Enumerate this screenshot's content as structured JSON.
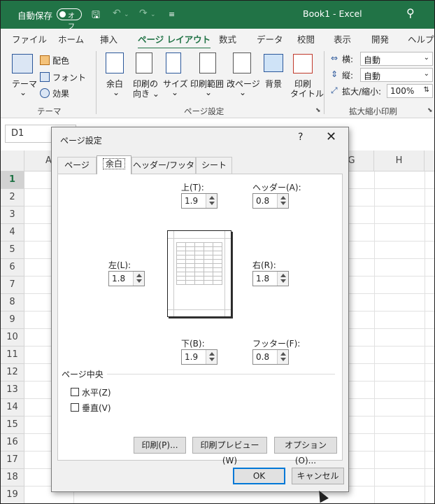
{
  "titlebar": {
    "autosave": "自動保存",
    "toggle_state": "オフ",
    "doc_title": "Book1  -  Excel",
    "bg": "#217346"
  },
  "ribbon_tabs": [
    "ファイル",
    "ホーム",
    "挿入",
    "ページ レイアウト",
    "数式",
    "データ",
    "校閲",
    "表示",
    "開発",
    "ヘルプ"
  ],
  "active_tab": "ページ レイアウト",
  "ribbon": {
    "theme_label_1": "テーマ",
    "theme_label_2": "⌄",
    "colors": "配色",
    "fonts": "フォント",
    "effects": "効果",
    "theme_group": "テーマ",
    "margins_1": "余白",
    "margins_2": "⌄",
    "orient_1": "印刷の",
    "orient_2": "向き ⌄",
    "size_1": "サイズ",
    "size_2": "⌄",
    "area_1": "印刷範囲",
    "area_2": "⌄",
    "breaks_1": "改ページ",
    "breaks_2": "⌄",
    "background": "背景",
    "titles_1": "印刷",
    "titles_2": "タイトル",
    "page_setup_group": "ページ設定",
    "width_label": "横:",
    "width_value": "自動",
    "height_label": "縦:",
    "height_value": "自動",
    "scale_label": "拡大/縮小:",
    "scale_value": "100%",
    "scale_group": "拡大縮小印刷"
  },
  "namebox": "D1",
  "columns": [
    "A",
    "G",
    "H"
  ],
  "rows": [
    "1",
    "2",
    "3",
    "4",
    "5",
    "6",
    "7",
    "8",
    "9",
    "10",
    "11",
    "12",
    "13",
    "14",
    "15",
    "16",
    "17",
    "18",
    "19"
  ],
  "dialog": {
    "title": "ページ設定",
    "help": "?",
    "close": "✕",
    "tabs": [
      "ページ",
      "余白",
      "ヘッダー/フッター",
      "シート"
    ],
    "active_tab": "余白",
    "top_label": "上(T):",
    "top_value": "1.9",
    "header_label": "ヘッダー(A):",
    "header_value": "0.8",
    "left_label": "左(L):",
    "left_value": "1.8",
    "right_label": "右(R):",
    "right_value": "1.8",
    "bottom_label": "下(B):",
    "bottom_value": "1.9",
    "footer_label": "フッター(F):",
    "footer_value": "0.8",
    "center_section": "ページ中央",
    "horizontal": "水平(Z)",
    "vertical": "垂直(V)",
    "print_button": "印刷(P)...",
    "preview_button": "印刷プレビュー(W)",
    "options_button": "オプション(O)...",
    "ok_button": "OK",
    "cancel_button": "キャンセル"
  }
}
